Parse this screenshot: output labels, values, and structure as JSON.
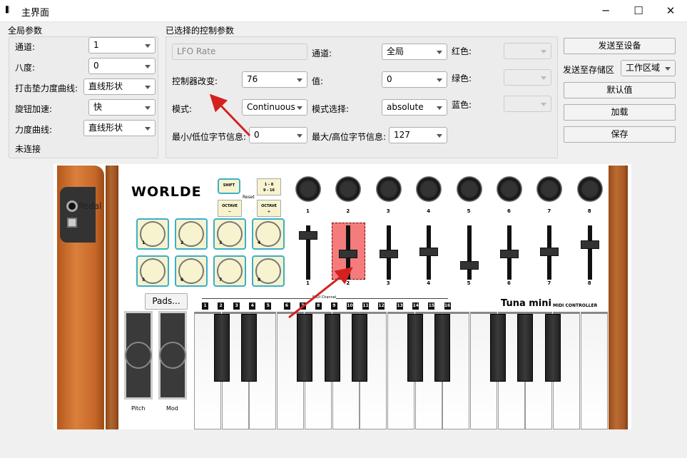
{
  "window": {
    "title": "主界面",
    "icon": "piano-icon",
    "controls": [
      "minimize",
      "maximize",
      "close"
    ]
  },
  "global": {
    "title": "全局参数",
    "rows": [
      {
        "label": "通道:",
        "value": "1"
      },
      {
        "label": "八度:",
        "value": "0"
      },
      {
        "label": "打击垫力度曲线:",
        "value": "直线形状"
      },
      {
        "label": "旋钮加速:",
        "value": "快"
      },
      {
        "label": "力度曲线:",
        "value": "直线形状"
      }
    ],
    "status": "未连接"
  },
  "selected": {
    "title": "已选择的控制参数",
    "name_field": "LFO Rate",
    "cc_label": "控制器改变:",
    "cc_value": "76",
    "mode_label": "模式:",
    "mode_value": "Continuous",
    "min_label": "最小/低位字节信息:",
    "min_value": "0",
    "channel_label": "通道:",
    "channel_value": "全局",
    "value_label": "值:",
    "value_value": "0",
    "mode_select_label": "模式选择:",
    "mode_select_value": "absolute",
    "max_label": "最大/高位字节信息:",
    "max_value": "127",
    "red_label": "红色:",
    "green_label": "绿色:",
    "blue_label": "蓝色:"
  },
  "actions": {
    "send_device": "发送至设备",
    "send_bank_label": "发送至存储区",
    "send_bank_value": "工作区域",
    "defaults": "默认值",
    "load": "加载",
    "save": "保存"
  },
  "device": {
    "brand": "WORLDE",
    "model": "Tuna mini",
    "model_sub": "MIDI CONTROLLER",
    "pedal": "Pedal",
    "shift": "SHIFT",
    "bank": "1 - 8\n9 - 16",
    "octave_minus": "OCTAVE\n−",
    "octave_plus": "OCTAVE\n+",
    "reset": "Reset",
    "pads_button": "Pads...",
    "pads": [
      "1",
      "2",
      "3",
      "4",
      "5",
      "6",
      "7",
      "8"
    ],
    "knobs": [
      "1",
      "2",
      "3",
      "4",
      "5",
      "6",
      "7",
      "8"
    ],
    "faders": [
      "1",
      "2",
      "3",
      "4",
      "5",
      "6",
      "7",
      "8"
    ],
    "fader_levels": [
      0.9,
      0.5,
      0.5,
      0.55,
      0.25,
      0.5,
      0.55,
      0.7
    ],
    "selected_fader": "2",
    "midi_channel": "MIDI Channel",
    "channels": [
      "1",
      "2",
      "3",
      "4",
      "5",
      "6",
      "7",
      "8",
      "9",
      "10",
      "11",
      "12",
      "13",
      "14",
      "15",
      "16"
    ],
    "pitch": "Pitch",
    "mod": "Mod",
    "highlight_color": "#f06a6a",
    "arrow_color": "#d42020"
  }
}
